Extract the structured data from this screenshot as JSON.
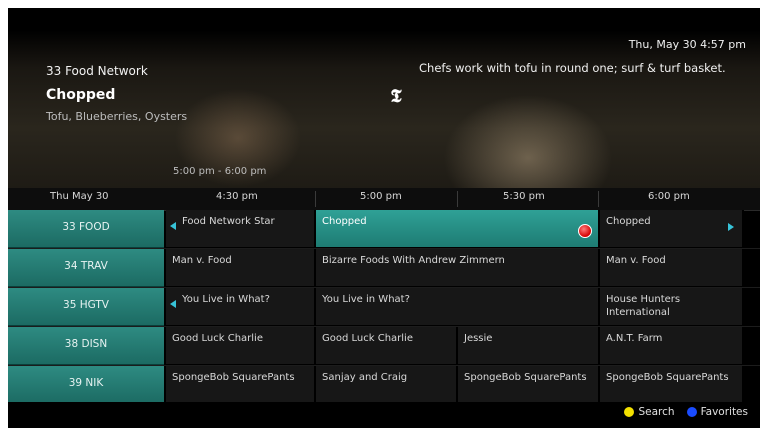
{
  "header": {
    "datetime": "Thu, May 30 4:57 pm"
  },
  "preview": {
    "channel": "33 Food Network",
    "title": "Chopped",
    "episode": "Tofu, Blueberries, Oysters",
    "time_range": "5:00 pm - 6:00 pm",
    "description": "Chefs work with tofu in round one; surf & turf basket.",
    "rating_icon": "tv-rating-icon"
  },
  "timebar": {
    "date": "Thu May 30",
    "slots": [
      "4:30 pm",
      "5:00 pm",
      "5:30 pm",
      "6:00 pm"
    ]
  },
  "grid": {
    "rows": [
      {
        "channel": "33 FOOD",
        "programs": [
          {
            "title": "Food Network Star",
            "left_arrow": true
          },
          {
            "title": "Chopped",
            "selected": true,
            "recording": true
          },
          {
            "title": "Chopped",
            "right_arrow": true
          }
        ]
      },
      {
        "channel": "34 TRAV",
        "programs": [
          {
            "title": "Man v. Food"
          },
          {
            "title": "Bizarre Foods With Andrew Zimmern"
          },
          {
            "title": "Man v. Food"
          }
        ]
      },
      {
        "channel": "35 HGTV",
        "programs": [
          {
            "title": "You Live in What?",
            "left_arrow": true
          },
          {
            "title": "You Live in What?"
          },
          {
            "title": "House Hunters International"
          }
        ]
      },
      {
        "channel": "38 DISN",
        "programs": [
          {
            "title": "Good Luck Charlie"
          },
          {
            "title": "Good Luck Charlie"
          },
          {
            "title": "Jessie"
          },
          {
            "title": "A.N.T. Farm"
          }
        ]
      },
      {
        "channel": "39 NIK",
        "programs": [
          {
            "title": "SpongeBob SquarePants"
          },
          {
            "title": "Sanjay and Craig"
          },
          {
            "title": "SpongeBob SquarePants"
          },
          {
            "title": "SpongeBob SquarePants"
          }
        ]
      }
    ]
  },
  "footer": {
    "search_label": "Search",
    "favorites_label": "Favorites",
    "search_color": "#f3e000",
    "favorites_color": "#1a4cff"
  },
  "colors": {
    "accent": "#2a9d92",
    "record": "#d40000"
  }
}
